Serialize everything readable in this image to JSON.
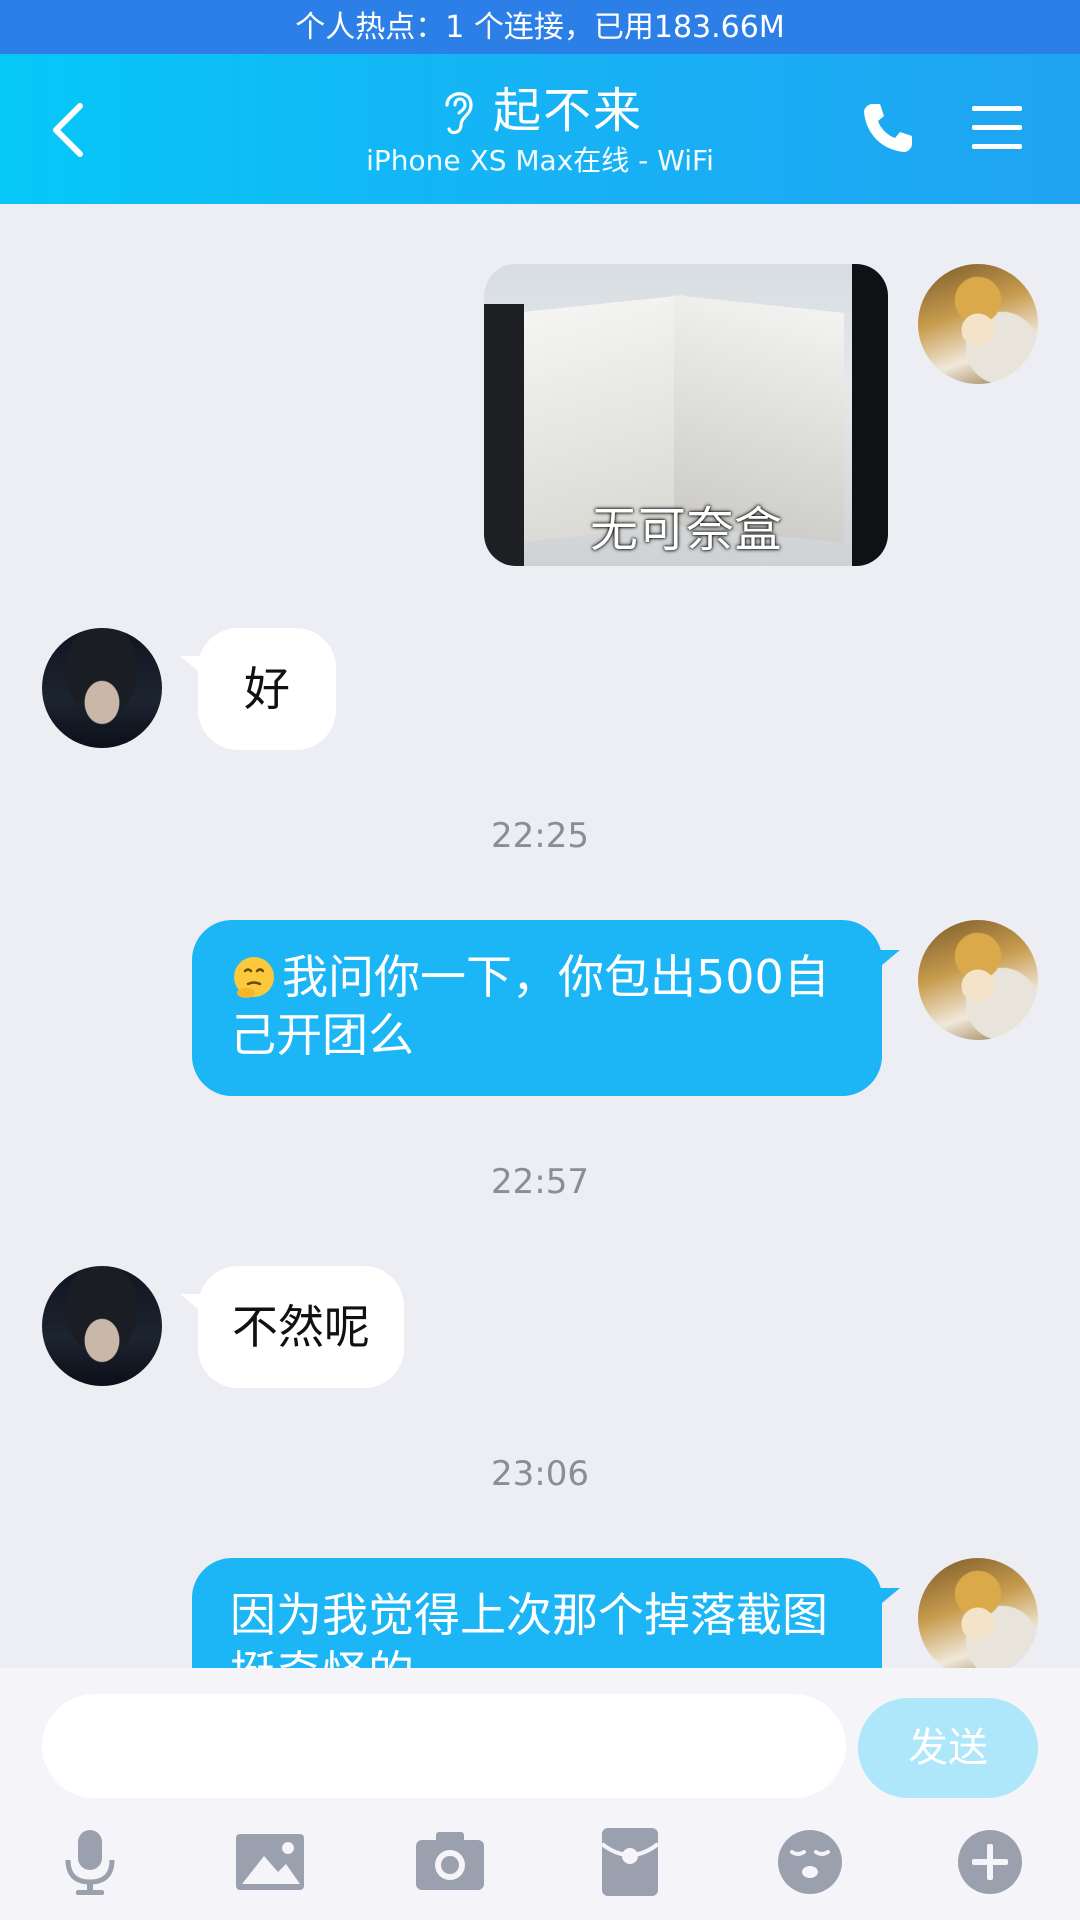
{
  "status_bar": {
    "text": "个人热点：1 个连接，已用183.66M"
  },
  "header": {
    "title": "起不来",
    "subtitle": "iPhone XS Max在线 - WiFi",
    "icons": [
      "back-arrow-icon",
      "ear-icon",
      "phone-icon",
      "menu-icon"
    ],
    "color": "#12b3f5"
  },
  "messages": [
    {
      "sender": "me",
      "type": "image",
      "caption": "无可奈盒"
    },
    {
      "sender": "them",
      "type": "text",
      "text": "好"
    },
    {
      "type": "time",
      "text": "22:25"
    },
    {
      "sender": "me",
      "type": "text",
      "emoji": "thinking-emoji",
      "text": "我问你一下，你包出500自己开团么"
    },
    {
      "type": "time",
      "text": "22:57"
    },
    {
      "sender": "them",
      "type": "text",
      "text": "不然呢"
    },
    {
      "type": "time",
      "text": "23:06"
    },
    {
      "sender": "me",
      "type": "text",
      "text": "因为我觉得上次那个掉落截图挺奇怪的"
    }
  ],
  "input": {
    "value": "",
    "placeholder": "",
    "send_label": "发送"
  },
  "toolbar": [
    "microphone-icon",
    "image-icon",
    "camera-icon",
    "red-packet-icon",
    "emoji-icon",
    "plus-icon"
  ],
  "colors": {
    "accent": "#1cb5f5",
    "status_bar": "#2d7fe8",
    "send_disabled": "#aee6fa",
    "background": "#ededf4"
  }
}
